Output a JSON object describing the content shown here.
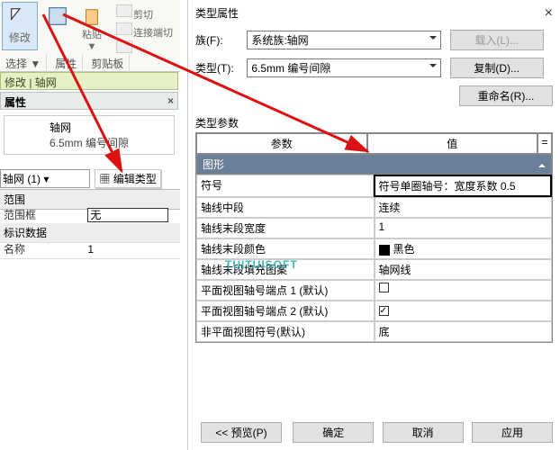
{
  "ribbon": {
    "modify": "修改",
    "select": "选择 ▼",
    "props": "属性",
    "clip": "剪贴板",
    "paste_row": "粘贴 ▼",
    "cut": "剪切",
    "copy_match": "连接端切"
  },
  "left": {
    "modify_bar": "修改 | 轴网",
    "props_title": "属性",
    "type_name": "轴网",
    "type_sub": "6.5mm 编号间隙",
    "combo": "轴网 (1)",
    "edit_type": "编辑类型",
    "group_range": "范围",
    "range_label": "范围框",
    "range_val": "无",
    "group_id": "标识数据",
    "name_label": "名称",
    "name_val": "1"
  },
  "dlg": {
    "title": "类型属性",
    "family_lbl": "族(F):",
    "family_val": "系统族:轴网",
    "type_lbl": "类型(T):",
    "type_val": "6.5mm 编号间隙",
    "load": "载入(L)...",
    "dup": "复制(D)...",
    "rename": "重命名(R)...",
    "sec": "类型参数",
    "col_param": "参数",
    "col_val": "值",
    "cat": "图形",
    "rows": [
      {
        "p": "符号",
        "v": "符号单圈轴号：宽度系数 0.5"
      },
      {
        "p": "轴线中段",
        "v": "连续"
      },
      {
        "p": "轴线末段宽度",
        "v": "1"
      },
      {
        "p": "轴线末段颜色",
        "v": "黑色"
      },
      {
        "p": "轴线末段填充图案",
        "v": "轴网线"
      },
      {
        "p": "平面视图轴号端点 1 (默认)",
        "v": ""
      },
      {
        "p": "平面视图轴号端点 2 (默认)",
        "v": ""
      },
      {
        "p": "非平面视图符号(默认)",
        "v": "底"
      }
    ],
    "preview": "<< 预览(P)",
    "ok": "确定",
    "cancel": "取消",
    "apply": "应用"
  },
  "watermark": "TUITUISOFT"
}
